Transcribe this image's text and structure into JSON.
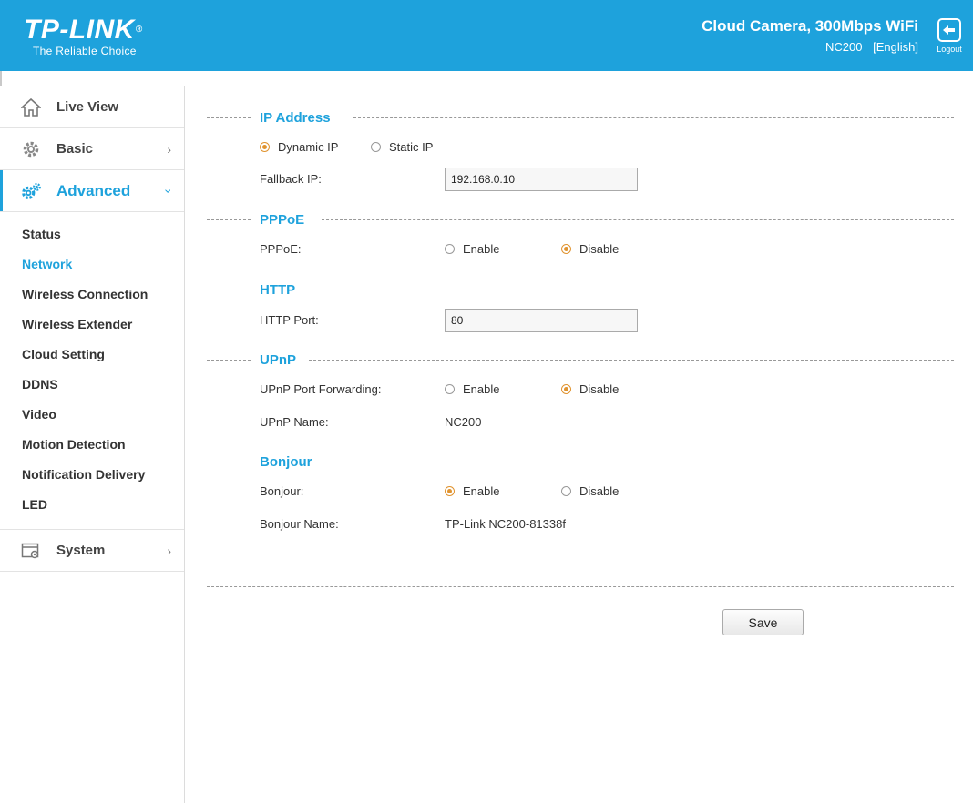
{
  "header": {
    "logo_text": "TP-LINK",
    "logo_reg": "®",
    "tagline": "The Reliable Choice",
    "product_title": "Cloud Camera, 300Mbps WiFi",
    "model": "NC200",
    "language": "[English]",
    "logout_label": "Logout",
    "brand_color": "#1ea2dc"
  },
  "sidebar": {
    "items": [
      {
        "label": "Live View",
        "icon": "home-icon"
      },
      {
        "label": "Basic",
        "icon": "gear-icon"
      },
      {
        "label": "Advanced",
        "icon": "gears-icon"
      },
      {
        "label": "System",
        "icon": "system-icon"
      }
    ],
    "advanced_sub": [
      "Status",
      "Network",
      "Wireless Connection",
      "Wireless Extender",
      "Cloud Setting",
      "DDNS",
      "Video",
      "Motion Detection",
      "Notification Delivery",
      "LED"
    ],
    "current_sub": "Network"
  },
  "ip": {
    "title": "IP Address",
    "dynamic_label": "Dynamic IP",
    "static_label": "Static IP",
    "fallback_label": "Fallback IP:",
    "fallback_value": "192.168.0.10"
  },
  "pppoe": {
    "title": "PPPoE",
    "label": "PPPoE:",
    "enable": "Enable",
    "disable": "Disable"
  },
  "http": {
    "title": "HTTP",
    "port_label": "HTTP Port:",
    "port_value": "80"
  },
  "upnp": {
    "title": "UPnP",
    "forward_label": "UPnP Port Forwarding:",
    "enable": "Enable",
    "disable": "Disable",
    "name_label": "UPnP Name:",
    "name_value": "NC200"
  },
  "bonjour": {
    "title": "Bonjour",
    "label": "Bonjour:",
    "enable": "Enable",
    "disable": "Disable",
    "name_label": "Bonjour Name:",
    "name_value": "TP-Link NC200-81338f"
  },
  "save_label": "Save",
  "accent_orange": "#e0932f"
}
